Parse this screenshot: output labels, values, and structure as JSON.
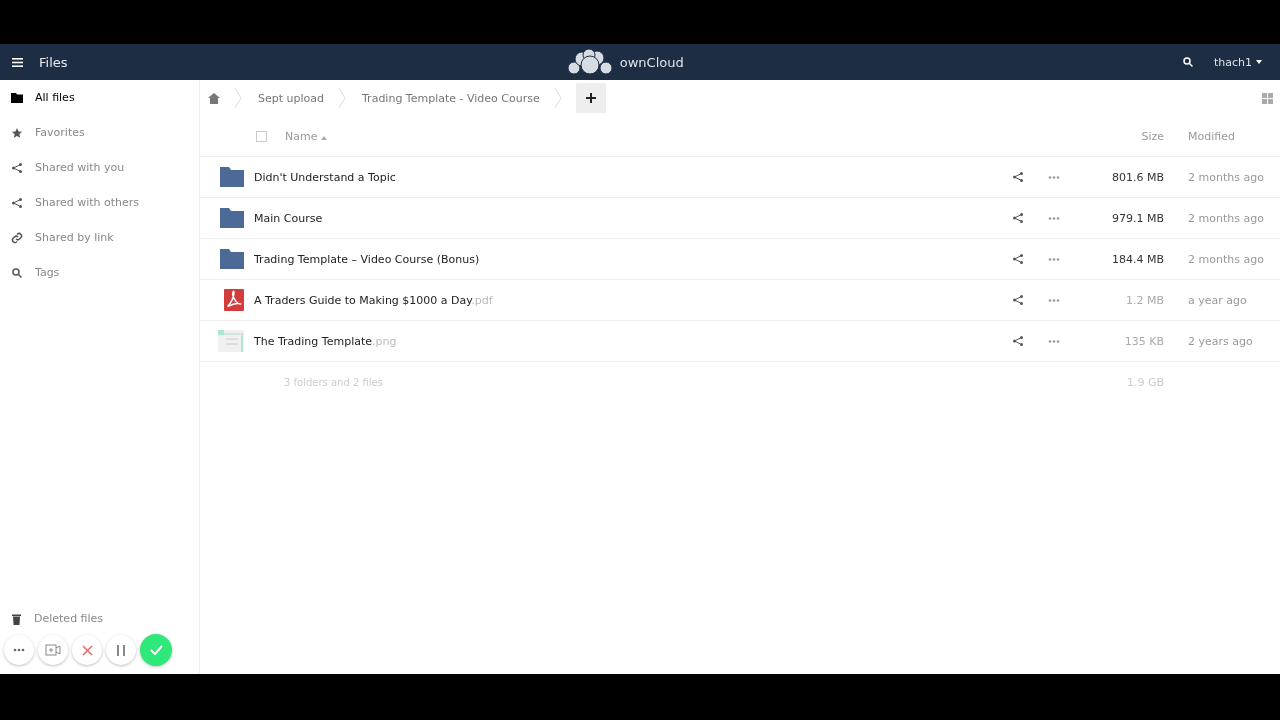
{
  "header": {
    "app_title": "Files",
    "brand": "ownCloud",
    "user": "thach1"
  },
  "sidebar": {
    "items": [
      {
        "label": "All files",
        "kind": "folder",
        "selected": true
      },
      {
        "label": "Favorites",
        "kind": "star",
        "selected": false
      },
      {
        "label": "Shared with you",
        "kind": "share",
        "selected": false
      },
      {
        "label": "Shared with others",
        "kind": "share",
        "selected": false
      },
      {
        "label": "Shared by link",
        "kind": "link",
        "selected": false
      },
      {
        "label": "Tags",
        "kind": "search",
        "selected": false
      }
    ],
    "bottom_items": [
      {
        "label": "Deleted files",
        "kind": "trash",
        "selected": false
      }
    ]
  },
  "breadcrumbs": [
    "Sept upload",
    "Trading Template - Video Course"
  ],
  "table": {
    "columns": [
      "Name",
      "Size",
      "Modified"
    ],
    "select_all": {
      "checked": false
    },
    "rows": [
      {
        "kind": "folder",
        "name": "Didn't Understand a Topic",
        "size": "801.6 MB",
        "modified": "2 months ago"
      },
      {
        "kind": "folder",
        "name": "Main Course",
        "size": "979.1 MB",
        "modified": "2 months ago"
      },
      {
        "kind": "folder",
        "name": "Trading Template – Video Course (Bonus)",
        "size": "184.4 MB",
        "modified": "2 months ago"
      },
      {
        "kind": "pdf",
        "name": "A Traders Guide to Making $1000 a Day",
        "extension": ".pdf",
        "size": "1.2 MB",
        "modified": "a year ago"
      },
      {
        "kind": "image",
        "name": "The Trading Template",
        "extension": ".png",
        "size": "135 KB",
        "modified": "2 years ago"
      }
    ],
    "summary": {
      "count": "3 folders and 2 files",
      "size": "1.9 GB"
    }
  },
  "recorder": {
    "buttons": [
      {
        "kind": "more"
      },
      {
        "kind": "camera"
      },
      {
        "kind": "cancel"
      },
      {
        "kind": "pause"
      },
      {
        "kind": "done"
      }
    ]
  }
}
